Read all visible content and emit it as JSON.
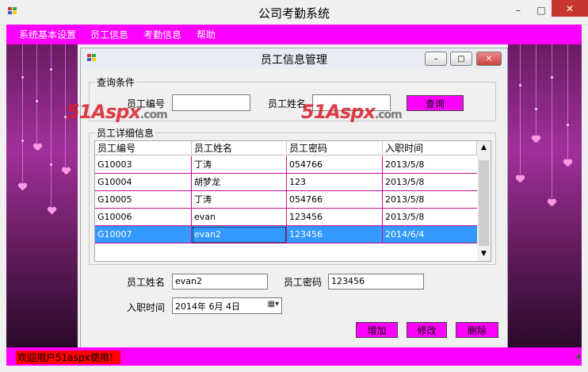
{
  "window": {
    "title": "公司考勤系统",
    "minimize": "–",
    "maximize": "□",
    "close": "✕"
  },
  "menu": [
    {
      "label": "系统基本设置"
    },
    {
      "label": "员工信息"
    },
    {
      "label": "考勤信息"
    },
    {
      "label": "帮助"
    }
  ],
  "form": {
    "title": "员工信息管理",
    "query": {
      "group_label": "查询条件",
      "id_label": "员工编号",
      "id_value": "",
      "name_label": "员工姓名",
      "name_value": "",
      "button": "查询"
    },
    "details": {
      "group_label": "员工详细信息",
      "columns": [
        "员工编号",
        "员工姓名",
        "员工密码",
        "入职时间"
      ],
      "rows": [
        [
          "G10003",
          "丁涛",
          "054766",
          "2013/5/8"
        ],
        [
          "G10004",
          "胡梦龙",
          "123",
          "2013/5/8"
        ],
        [
          "G10005",
          "丁涛",
          "054766",
          "2013/5/8"
        ],
        [
          "G10006",
          "evan",
          "123456",
          "2013/5/8"
        ],
        [
          "G10007",
          "evan2",
          "123456",
          "2014/6/4"
        ]
      ],
      "selected_row": 4
    },
    "edit": {
      "name_label": "员工姓名",
      "name_value": "evan2",
      "password_label": "员工密码",
      "password_value": "123456",
      "date_label": "入职时间",
      "date_value": "2014年 6月 4日"
    },
    "buttons": {
      "add": "增加",
      "edit": "修改",
      "delete": "删除"
    }
  },
  "watermark": {
    "brand": "51Aspx",
    "suffix": ".com"
  },
  "status": {
    "text": "欢迎用户51aspx使用！"
  },
  "colors": {
    "accent": "#ff00ff",
    "selection": "#3399ff",
    "status_highlight": "#ff0000"
  }
}
